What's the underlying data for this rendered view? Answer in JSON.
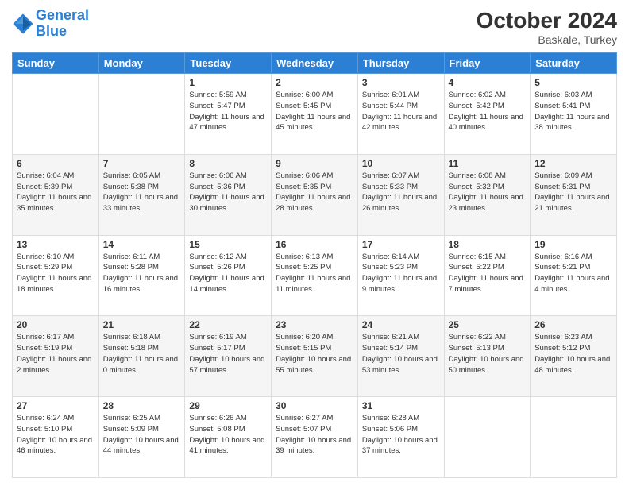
{
  "header": {
    "logo_line1": "General",
    "logo_line2": "Blue",
    "month_year": "October 2024",
    "location": "Baskale, Turkey"
  },
  "days_of_week": [
    "Sunday",
    "Monday",
    "Tuesday",
    "Wednesday",
    "Thursday",
    "Friday",
    "Saturday"
  ],
  "weeks": [
    [
      {
        "day": null
      },
      {
        "day": null
      },
      {
        "day": "1",
        "sunrise": "Sunrise: 5:59 AM",
        "sunset": "Sunset: 5:47 PM",
        "daylight": "Daylight: 11 hours and 47 minutes."
      },
      {
        "day": "2",
        "sunrise": "Sunrise: 6:00 AM",
        "sunset": "Sunset: 5:45 PM",
        "daylight": "Daylight: 11 hours and 45 minutes."
      },
      {
        "day": "3",
        "sunrise": "Sunrise: 6:01 AM",
        "sunset": "Sunset: 5:44 PM",
        "daylight": "Daylight: 11 hours and 42 minutes."
      },
      {
        "day": "4",
        "sunrise": "Sunrise: 6:02 AM",
        "sunset": "Sunset: 5:42 PM",
        "daylight": "Daylight: 11 hours and 40 minutes."
      },
      {
        "day": "5",
        "sunrise": "Sunrise: 6:03 AM",
        "sunset": "Sunset: 5:41 PM",
        "daylight": "Daylight: 11 hours and 38 minutes."
      }
    ],
    [
      {
        "day": "6",
        "sunrise": "Sunrise: 6:04 AM",
        "sunset": "Sunset: 5:39 PM",
        "daylight": "Daylight: 11 hours and 35 minutes."
      },
      {
        "day": "7",
        "sunrise": "Sunrise: 6:05 AM",
        "sunset": "Sunset: 5:38 PM",
        "daylight": "Daylight: 11 hours and 33 minutes."
      },
      {
        "day": "8",
        "sunrise": "Sunrise: 6:06 AM",
        "sunset": "Sunset: 5:36 PM",
        "daylight": "Daylight: 11 hours and 30 minutes."
      },
      {
        "day": "9",
        "sunrise": "Sunrise: 6:06 AM",
        "sunset": "Sunset: 5:35 PM",
        "daylight": "Daylight: 11 hours and 28 minutes."
      },
      {
        "day": "10",
        "sunrise": "Sunrise: 6:07 AM",
        "sunset": "Sunset: 5:33 PM",
        "daylight": "Daylight: 11 hours and 26 minutes."
      },
      {
        "day": "11",
        "sunrise": "Sunrise: 6:08 AM",
        "sunset": "Sunset: 5:32 PM",
        "daylight": "Daylight: 11 hours and 23 minutes."
      },
      {
        "day": "12",
        "sunrise": "Sunrise: 6:09 AM",
        "sunset": "Sunset: 5:31 PM",
        "daylight": "Daylight: 11 hours and 21 minutes."
      }
    ],
    [
      {
        "day": "13",
        "sunrise": "Sunrise: 6:10 AM",
        "sunset": "Sunset: 5:29 PM",
        "daylight": "Daylight: 11 hours and 18 minutes."
      },
      {
        "day": "14",
        "sunrise": "Sunrise: 6:11 AM",
        "sunset": "Sunset: 5:28 PM",
        "daylight": "Daylight: 11 hours and 16 minutes."
      },
      {
        "day": "15",
        "sunrise": "Sunrise: 6:12 AM",
        "sunset": "Sunset: 5:26 PM",
        "daylight": "Daylight: 11 hours and 14 minutes."
      },
      {
        "day": "16",
        "sunrise": "Sunrise: 6:13 AM",
        "sunset": "Sunset: 5:25 PM",
        "daylight": "Daylight: 11 hours and 11 minutes."
      },
      {
        "day": "17",
        "sunrise": "Sunrise: 6:14 AM",
        "sunset": "Sunset: 5:23 PM",
        "daylight": "Daylight: 11 hours and 9 minutes."
      },
      {
        "day": "18",
        "sunrise": "Sunrise: 6:15 AM",
        "sunset": "Sunset: 5:22 PM",
        "daylight": "Daylight: 11 hours and 7 minutes."
      },
      {
        "day": "19",
        "sunrise": "Sunrise: 6:16 AM",
        "sunset": "Sunset: 5:21 PM",
        "daylight": "Daylight: 11 hours and 4 minutes."
      }
    ],
    [
      {
        "day": "20",
        "sunrise": "Sunrise: 6:17 AM",
        "sunset": "Sunset: 5:19 PM",
        "daylight": "Daylight: 11 hours and 2 minutes."
      },
      {
        "day": "21",
        "sunrise": "Sunrise: 6:18 AM",
        "sunset": "Sunset: 5:18 PM",
        "daylight": "Daylight: 11 hours and 0 minutes."
      },
      {
        "day": "22",
        "sunrise": "Sunrise: 6:19 AM",
        "sunset": "Sunset: 5:17 PM",
        "daylight": "Daylight: 10 hours and 57 minutes."
      },
      {
        "day": "23",
        "sunrise": "Sunrise: 6:20 AM",
        "sunset": "Sunset: 5:15 PM",
        "daylight": "Daylight: 10 hours and 55 minutes."
      },
      {
        "day": "24",
        "sunrise": "Sunrise: 6:21 AM",
        "sunset": "Sunset: 5:14 PM",
        "daylight": "Daylight: 10 hours and 53 minutes."
      },
      {
        "day": "25",
        "sunrise": "Sunrise: 6:22 AM",
        "sunset": "Sunset: 5:13 PM",
        "daylight": "Daylight: 10 hours and 50 minutes."
      },
      {
        "day": "26",
        "sunrise": "Sunrise: 6:23 AM",
        "sunset": "Sunset: 5:12 PM",
        "daylight": "Daylight: 10 hours and 48 minutes."
      }
    ],
    [
      {
        "day": "27",
        "sunrise": "Sunrise: 6:24 AM",
        "sunset": "Sunset: 5:10 PM",
        "daylight": "Daylight: 10 hours and 46 minutes."
      },
      {
        "day": "28",
        "sunrise": "Sunrise: 6:25 AM",
        "sunset": "Sunset: 5:09 PM",
        "daylight": "Daylight: 10 hours and 44 minutes."
      },
      {
        "day": "29",
        "sunrise": "Sunrise: 6:26 AM",
        "sunset": "Sunset: 5:08 PM",
        "daylight": "Daylight: 10 hours and 41 minutes."
      },
      {
        "day": "30",
        "sunrise": "Sunrise: 6:27 AM",
        "sunset": "Sunset: 5:07 PM",
        "daylight": "Daylight: 10 hours and 39 minutes."
      },
      {
        "day": "31",
        "sunrise": "Sunrise: 6:28 AM",
        "sunset": "Sunset: 5:06 PM",
        "daylight": "Daylight: 10 hours and 37 minutes."
      },
      {
        "day": null
      },
      {
        "day": null
      }
    ]
  ]
}
